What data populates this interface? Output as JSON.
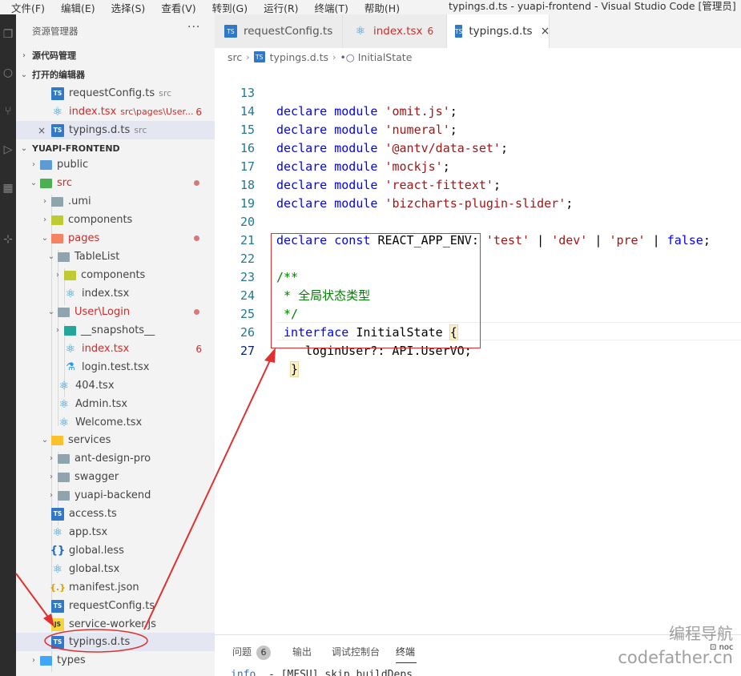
{
  "window": {
    "menu": [
      "文件(F)",
      "编辑(E)",
      "选择(S)",
      "查看(V)",
      "转到(G)",
      "运行(R)",
      "终端(T)",
      "帮助(H)"
    ],
    "title": "typings.d.ts - yuapi-frontend - Visual Studio Code [管理员]"
  },
  "explorer": {
    "title": "资源管理器",
    "more": "···",
    "source_control": "源代码管理",
    "open_editors": "打开的编辑器",
    "open_files": [
      {
        "name": "requestConfig.ts",
        "desc": "src",
        "icon": "ts-icon"
      },
      {
        "name": "index.tsx",
        "desc": "src\\pages\\User...",
        "badge": "6",
        "icon": "react-icon"
      },
      {
        "name": "typings.d.ts",
        "desc": "src",
        "icon": "ts-icon",
        "close": "×"
      }
    ],
    "project": "YUAPI-FRONTEND",
    "tree": [
      {
        "name": "public",
        "icon": "folder-public",
        "chev": "›"
      },
      {
        "name": "src",
        "icon": "folder-src",
        "chev": "⌄"
      },
      {
        "name": ".umi",
        "icon": "folder",
        "chev": "›"
      },
      {
        "name": "components",
        "icon": "folder-yellowgreen",
        "chev": "›"
      },
      {
        "name": "pages",
        "icon": "folder-pages",
        "chev": "⌄"
      },
      {
        "name": "TableList",
        "icon": "folder",
        "chev": "⌄"
      },
      {
        "name": "components",
        "icon": "folder-yellowgreen",
        "chev": "›"
      },
      {
        "name": "index.tsx",
        "icon": "react-icon"
      },
      {
        "name": "User\\Login",
        "icon": "folder",
        "chev": "⌄"
      },
      {
        "name": "__snapshots__",
        "icon": "folder-teal",
        "chev": "›"
      },
      {
        "name": "index.tsx",
        "icon": "react-icon",
        "badge": "6"
      },
      {
        "name": "login.test.tsx",
        "icon": "flask-icon"
      },
      {
        "name": "404.tsx",
        "icon": "react-icon"
      },
      {
        "name": "Admin.tsx",
        "icon": "react-icon"
      },
      {
        "name": "Welcome.tsx",
        "icon": "react-icon"
      },
      {
        "name": "services",
        "icon": "folder-services",
        "chev": "⌄"
      },
      {
        "name": "ant-design-pro",
        "icon": "folder",
        "chev": "›"
      },
      {
        "name": "swagger",
        "icon": "folder",
        "chev": "›"
      },
      {
        "name": "yuapi-backend",
        "icon": "folder",
        "chev": "›"
      },
      {
        "name": "access.ts",
        "icon": "ts-icon"
      },
      {
        "name": "app.tsx",
        "icon": "react-icon"
      },
      {
        "name": "global.less",
        "icon": "braces-icon"
      },
      {
        "name": "global.tsx",
        "icon": "react-icon"
      },
      {
        "name": "manifest.json",
        "icon": "json-icon"
      },
      {
        "name": "requestConfig.ts",
        "icon": "ts-icon"
      },
      {
        "name": "service-worker.js",
        "icon": "js-icon"
      },
      {
        "name": "typings.d.ts",
        "icon": "ts-icon"
      },
      {
        "name": "types",
        "icon": "folder-blue",
        "chev": "›"
      }
    ]
  },
  "tabs": [
    {
      "label": "requestConfig.ts",
      "icon": "ts-icon"
    },
    {
      "label": "index.tsx",
      "icon": "react-icon",
      "badge": "6"
    },
    {
      "label": "typings.d.ts",
      "icon": "ts-icon",
      "close": "×"
    }
  ],
  "breadcrumb": {
    "folder": "src",
    "file": "typings.d.ts",
    "symbol": "InitialState",
    "sep": "›"
  },
  "code": {
    "lines": [
      {
        "n": "13",
        "mod": "'omit.js'"
      },
      {
        "n": "14",
        "mod": "'numeral'"
      },
      {
        "n": "15",
        "mod": "'@antv/data-set'"
      },
      {
        "n": "16",
        "mod": "'mockjs'"
      },
      {
        "n": "17",
        "mod": "'react-fittext'"
      },
      {
        "n": "18",
        "mod": "'bizcharts-plugin-slider'"
      },
      {
        "n": "19"
      },
      {
        "n": "20"
      },
      {
        "n": "21"
      },
      {
        "n": "22"
      },
      {
        "n": "23"
      },
      {
        "n": "24"
      },
      {
        "n": "25"
      },
      {
        "n": "26"
      },
      {
        "n": "27"
      }
    ],
    "kw_declare": "declare",
    "kw_module": "module",
    "kw_const": "const",
    "kw_interface": "interface",
    "semicolon": ";",
    "env_name": "REACT_APP_ENV",
    "env_colon": ":",
    "env_v1": "'test'",
    "env_v2": "'dev'",
    "env_v3": "'pre'",
    "pipe": "|",
    "env_false": "false",
    "comment_open": "/**",
    "comment_text": " * 全局状态类型",
    "comment_close": " */",
    "iface_name": "InitialState",
    "brace_open": "{",
    "brace_close": "}",
    "prop_name": "loginUser?",
    "prop_colon": ":",
    "prop_type": "API.UserVO"
  },
  "panel": {
    "problems": "问题",
    "problems_count": "6",
    "output": "输出",
    "debug_console": "调试控制台",
    "terminal": "终端",
    "terminal_info": "info",
    "terminal_text": "- [MFSU] skip buildDeps",
    "terminal_node": "noc"
  },
  "watermark": {
    "line1": "编程导航",
    "line2": "codefather.cn"
  },
  "colors": {
    "annotation": "#e03030",
    "keyword": "#0000ff",
    "string": "#a31515",
    "comment": "#008000"
  }
}
